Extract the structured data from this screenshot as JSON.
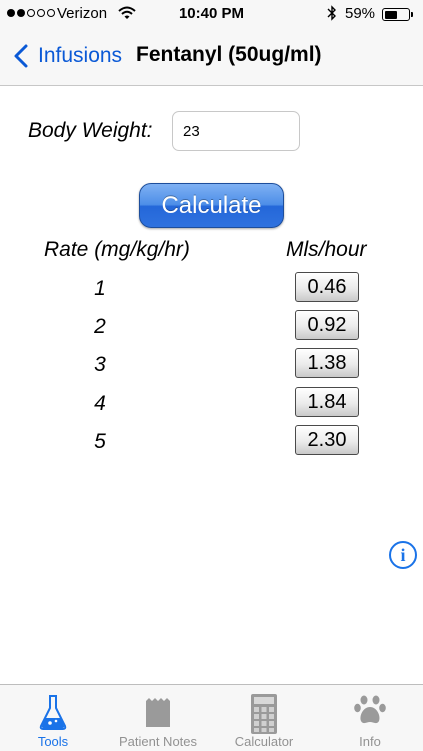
{
  "status_bar": {
    "carrier": "Verizon",
    "time": "10:40 PM",
    "battery": "59%"
  },
  "nav": {
    "back_label": "Infusions",
    "title": "Fentanyl (50ug/ml)"
  },
  "form": {
    "body_weight_label": "Body Weight:",
    "body_weight_value": "23",
    "calculate_label": "Calculate"
  },
  "table": {
    "headers": [
      "Rate (mg/kg/hr)",
      "Mls/hour"
    ],
    "rows": [
      {
        "rate": "1",
        "mls": "0.46"
      },
      {
        "rate": "2",
        "mls": "0.92"
      },
      {
        "rate": "3",
        "mls": "1.38"
      },
      {
        "rate": "4",
        "mls": "1.84"
      },
      {
        "rate": "5",
        "mls": "2.30"
      }
    ]
  },
  "info_button": {
    "label": "i",
    "icon": "info-icon"
  },
  "tab_bar": {
    "active_index": 0,
    "items": [
      {
        "label": "Tools",
        "icon": "flask-icon"
      },
      {
        "label": "Patient Notes",
        "icon": "notepad-icon"
      },
      {
        "label": "Calculator",
        "icon": "calculator-icon"
      },
      {
        "label": "Info",
        "icon": "paw-icon"
      }
    ]
  },
  "colors": {
    "accent": "#1a73e8",
    "back_link": "#0a59d6",
    "button_blue": "#2f72df",
    "inactive_tab": "#929292"
  }
}
